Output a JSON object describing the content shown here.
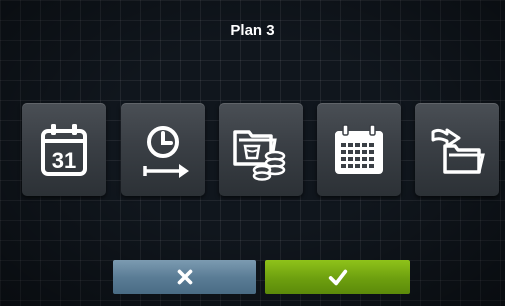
{
  "dialog": {
    "title": "Plan 3"
  },
  "icons": [
    {
      "name": "calendar-day-icon",
      "text": "31"
    },
    {
      "name": "time-delay-icon"
    },
    {
      "name": "wash-cost-icon"
    },
    {
      "name": "calendar-grid-icon"
    },
    {
      "name": "folder-import-icon"
    }
  ],
  "buttons": {
    "cancel": {
      "icon": "close-icon",
      "color": "#5b7d96"
    },
    "confirm": {
      "icon": "checkmark-icon",
      "color": "#7bb016"
    }
  }
}
